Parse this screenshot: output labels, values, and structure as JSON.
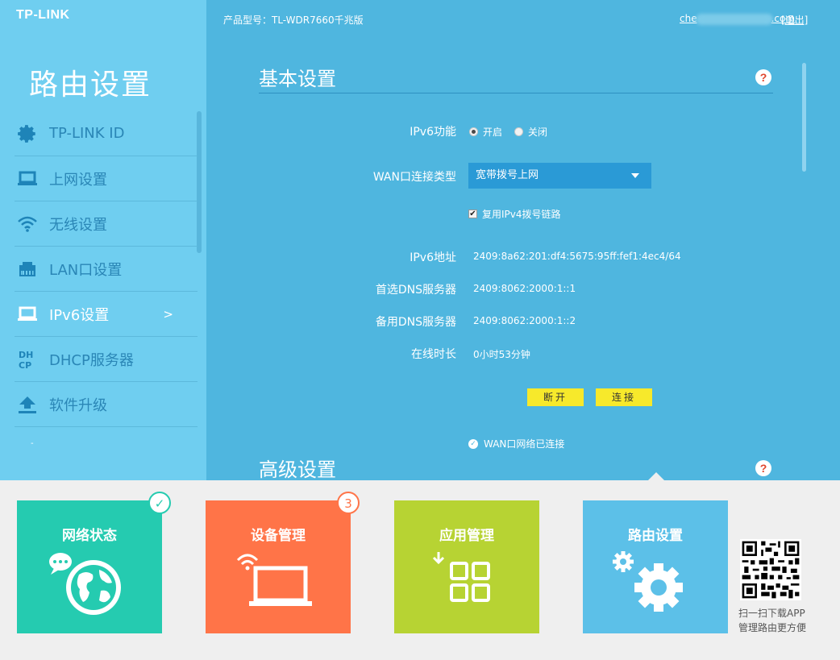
{
  "brand": {
    "logo": "TP-LINK"
  },
  "topbar": {
    "model": "产品型号：TL-WDR7660千兆版",
    "user_prefix": "che",
    "user_suffix": ".com",
    "logout": "[退出]"
  },
  "sidebar": {
    "title": "路由设置",
    "items": [
      {
        "label": "TP-LINK ID",
        "icon": "gear-icon"
      },
      {
        "label": "上网设置",
        "icon": "laptop-icon"
      },
      {
        "label": "无线设置",
        "icon": "wifi-icon"
      },
      {
        "label": "LAN口设置",
        "icon": "ethernet-port-icon"
      },
      {
        "label": "IPv6设置",
        "icon": "laptop-icon",
        "arrow": ">"
      },
      {
        "label": "DHCP服务器",
        "icon": "dhcp-icon"
      },
      {
        "label": "软件升级",
        "icon": "upload-icon"
      }
    ],
    "active_index": 4,
    "dash": "-"
  },
  "basic": {
    "title": "基本设置",
    "help": "?",
    "ipv6_label": "IPv6功能",
    "ipv6_on": "开启",
    "ipv6_off": "关闭",
    "ipv6_selected": "开启",
    "wan_type_label": "WAN口连接类型",
    "wan_type_value": "宽带拨号上网",
    "reuse_label": "复用IPv4拨号链路",
    "reuse_checked": true,
    "addr_label": "IPv6地址",
    "addr_value": "2409:8a62:201:df4:5675:95ff:fef1:4ec4/64",
    "dns1_label": "首选DNS服务器",
    "dns1_value": "2409:8062:2000:1::1",
    "dns2_label": "备用DNS服务器",
    "dns2_value": "2409:8062:2000:1::2",
    "online_label": "在线时长",
    "online_value": "0小时53分钟",
    "disconnect": "断开",
    "connect": "连接",
    "status": "WAN口网络已连接"
  },
  "advanced": {
    "title": "高级设置",
    "help": "?"
  },
  "tiles": [
    {
      "title": "网络状态",
      "color": "#25cbb0",
      "badge": "✓"
    },
    {
      "title": "设备管理",
      "color": "#ff7448",
      "badge": "3"
    },
    {
      "title": "应用管理",
      "color": "#b7d333"
    },
    {
      "title": "路由设置",
      "color": "#5cc0e8"
    }
  ],
  "qr": {
    "line1": "扫一扫下载APP",
    "line2": "管理路由更方便"
  },
  "colors": {
    "accent": "#4fb6df",
    "sidebar": "#6fcef0",
    "button": "#f7e92b",
    "help_mark": "#e0462d"
  }
}
